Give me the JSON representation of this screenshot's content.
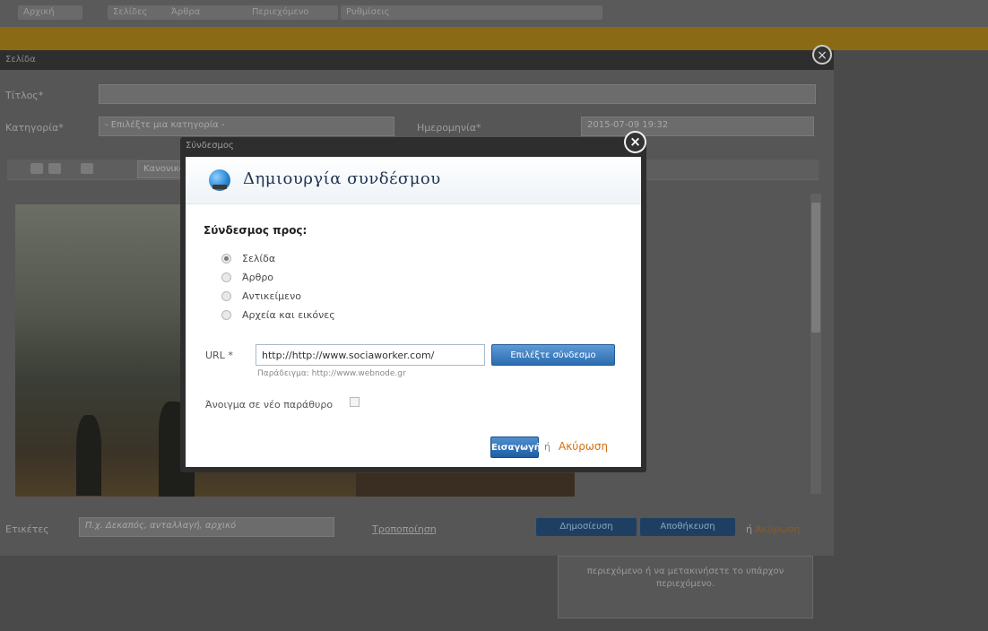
{
  "background": {
    "topbar_items": [
      "Αρχική",
      "Σελίδες",
      "Άρθρα",
      "Περιεχόμενο",
      "Ρυθμίσεις"
    ],
    "note_text": "περιεχόμενο ή να μετακινήσετε το υπάρχον περιεχόμενο."
  },
  "editor": {
    "window_title": "Σελίδα",
    "title_label": "Τίτλος*",
    "category_label": "Κατηγορία*",
    "category_value": "- Επιλέξτε μια κατηγορία -",
    "date_label": "Ημερομηνία*",
    "date_value": "2015-07-09 19:32",
    "format_select": "Κανονικό",
    "tags_label": "Ετικέτες",
    "tags_placeholder": "Π.χ. Δεκαπός, ανταλλαγή, αρχικό",
    "tags_link": "Τροποποίηση",
    "publish_label": "Δημοσίευση",
    "save_label": "Αποθήκευση",
    "or_text": "ή",
    "cancel_label": "Ακύρωση"
  },
  "dialog": {
    "window_title": "Σύνδεσμος",
    "heading": "Δημιουργία συνδέσμου",
    "link_to_label": "Σύνδεσμος προς:",
    "options": [
      {
        "label": "Σελίδα",
        "checked": true
      },
      {
        "label": "Άρθρο",
        "checked": false
      },
      {
        "label": "Αντικείμενο",
        "checked": false
      },
      {
        "label": "Αρχεία και εικόνες",
        "checked": false
      }
    ],
    "url_label": "URL *",
    "url_value": "http://http://www.sociaworker.com/",
    "choose_link_label": "Επιλέξτε σύνδεσμο",
    "url_hint": "Παράδειγμα: http://www.webnode.gr",
    "new_window_label": "Άνοιγμα σε νέο παράθυρο",
    "new_window_checked": false,
    "insert_label": "Εισαγωγή",
    "or_text": "ή",
    "cancel_label": "Ακύρωση"
  }
}
